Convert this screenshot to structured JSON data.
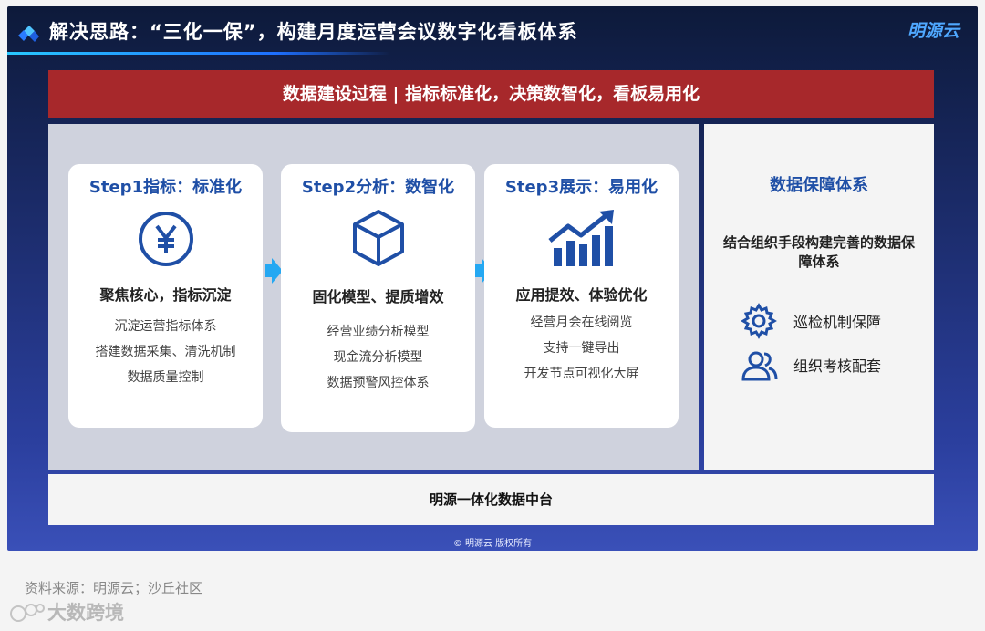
{
  "header": {
    "title": "解决思路：“三化一保”，构建月度运营会议数字化看板体系",
    "logo": "明源云",
    "icon": "diamond-logo-icon"
  },
  "banner": {
    "text": "数据建设过程 | 指标标准化，决策数智化，看板易用化"
  },
  "steps": [
    {
      "title": "Step1指标：标准化",
      "icon": "yen-circle-icon",
      "head": "聚焦核心，指标沉淀",
      "items": [
        "沉淀运营指标体系",
        "搭建数据采集、清洗机制",
        "数据质量控制"
      ]
    },
    {
      "title": "Step2分析：数智化",
      "icon": "cube-icon",
      "head": "固化模型、提质增效",
      "items": [
        "经营业绩分析模型",
        "现金流分析模型",
        "数据预警风控体系"
      ]
    },
    {
      "title": "Step3展示：易用化",
      "icon": "growth-chart-icon",
      "head": "应用提效、体验优化",
      "items": [
        "经营月会在线阅览",
        "支持一键导出",
        "开发节点可视化大屏"
      ]
    }
  ],
  "guarantee": {
    "title": "数据保障体系",
    "desc": "结合组织手段构建完善的数据保障体系",
    "items": [
      {
        "icon": "gear-icon",
        "label": "巡检机制保障"
      },
      {
        "icon": "users-icon",
        "label": "组织考核配套"
      }
    ]
  },
  "platform": {
    "text": "明源一体化数据中台"
  },
  "copyright": "© 明源云   版权所有",
  "source": "资料来源：明源云；沙丘社区",
  "watermark": "大数跨境",
  "colors": {
    "banner": "#a7282b",
    "accent": "#1f4fa6",
    "arrow": "#25a8f2"
  }
}
